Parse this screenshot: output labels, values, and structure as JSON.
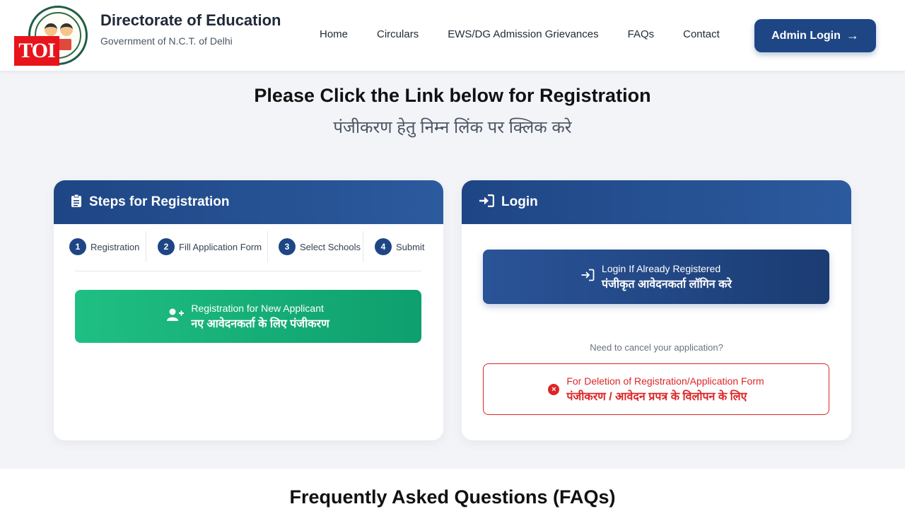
{
  "header": {
    "title": "Directorate of Education",
    "subtitle": "Government of N.C.T. of Delhi",
    "watermark": "TOI",
    "nav": [
      "Home",
      "Circulars",
      "EWS/DG Admission Grievances",
      "FAQs",
      "Contact"
    ],
    "admin_login": "Admin Login"
  },
  "hero": {
    "title": "Please Click the Link below for Registration",
    "subtitle": "पंजीकरण हेतु निम्न लिंक पर क्लिक करे"
  },
  "steps_card": {
    "title": "Steps for Registration",
    "steps": [
      {
        "num": "1",
        "label": "Registration"
      },
      {
        "num": "2",
        "label": "Fill Application Form"
      },
      {
        "num": "3",
        "label": "Select Schools"
      },
      {
        "num": "4",
        "label": "Submit"
      }
    ],
    "register_button": {
      "line1": "Registration for New Applicant",
      "line2": "नए आवेदनकर्ता के लिए पंजीकरण"
    }
  },
  "login_card": {
    "title": "Login",
    "login_button": {
      "line1": "Login If Already Registered",
      "line2": "पंजीकृत आवेदनकर्ता लॉगिन करे"
    },
    "cancel_question": "Need to cancel your application?",
    "delete_button": {
      "line1": "For Deletion of Registration/Application Form",
      "line2": "पंजीकरण / आवेदन प्रपत्र के विलोपन के लिए"
    }
  },
  "faq": {
    "title": "Frequently Asked Questions (FAQs)"
  },
  "colors": {
    "primary": "#1e4685",
    "success": "#10b981",
    "danger": "#dc2626",
    "toi_red": "#e8141c"
  },
  "icons": {
    "steps_card": "clipboard-list-icon",
    "login_card": "sign-in-icon",
    "register_button": "user-plus-icon",
    "login_button": "sign-in-icon",
    "delete_button": "times-circle-icon",
    "admin_login": "arrow-right-icon"
  }
}
